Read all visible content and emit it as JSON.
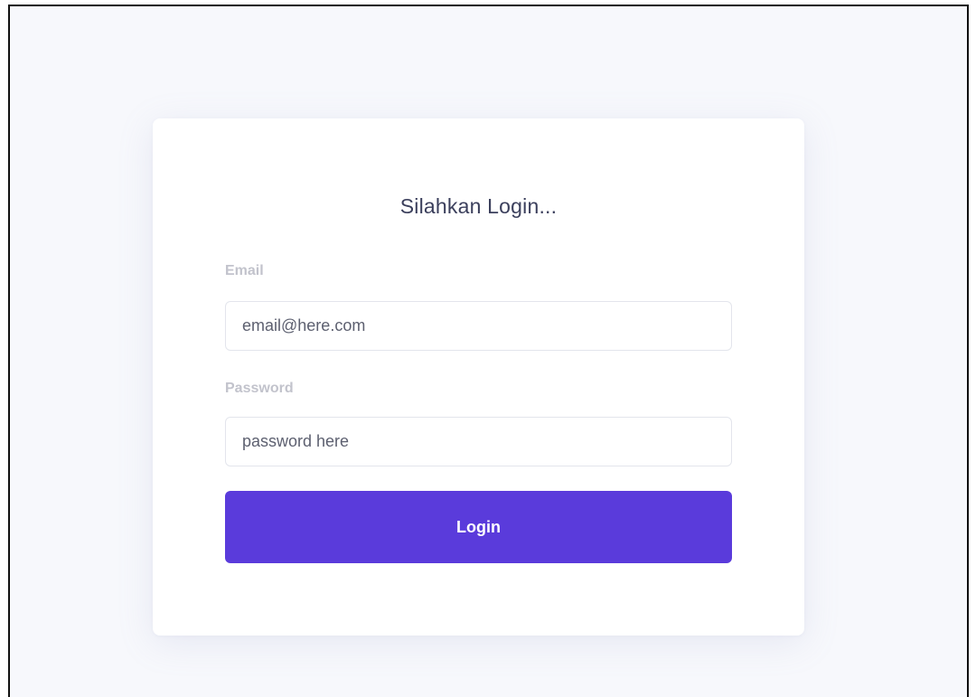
{
  "login": {
    "title": "Silahkan Login...",
    "email_label": "Email",
    "email_placeholder": "email@here.com",
    "password_label": "Password",
    "password_placeholder": "password here",
    "button_label": "Login"
  },
  "colors": {
    "page_background": "#f7f8fc",
    "card_background": "#ffffff",
    "accent": "#5a3bdb",
    "title_text": "#3b3f5c",
    "label_text": "#c2c3cc"
  }
}
